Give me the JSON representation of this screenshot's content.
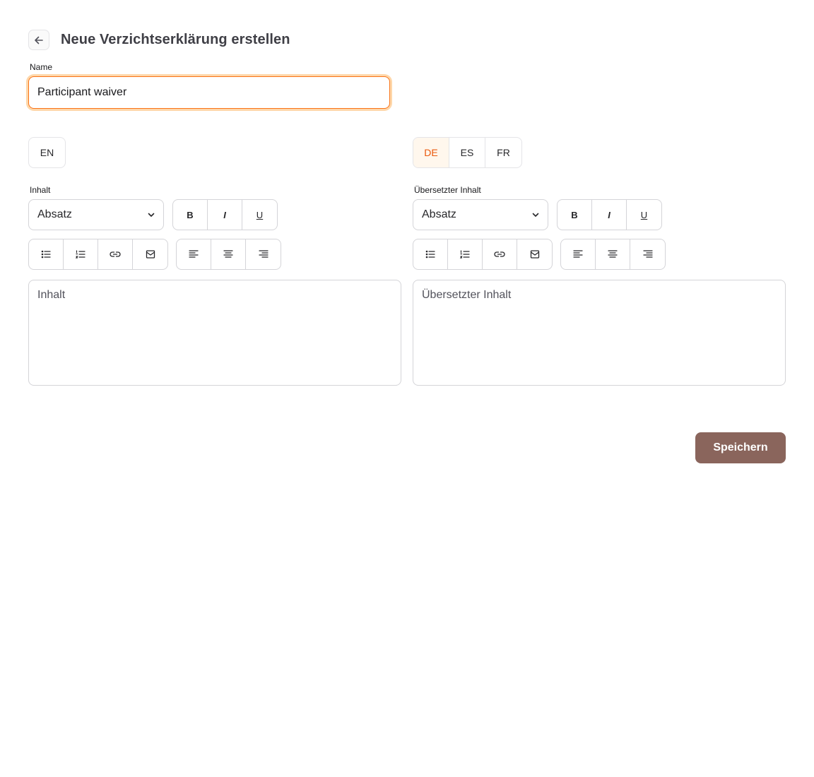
{
  "header": {
    "title": "Neue Verzichtserklärung erstellen"
  },
  "name_field": {
    "label": "Name",
    "value": "Participant waiver"
  },
  "source_panel": {
    "languages": [
      {
        "label": "EN",
        "active": false
      }
    ],
    "content_label": "Inhalt",
    "block_type": "Absatz",
    "editor_placeholder": "Inhalt"
  },
  "translation_panel": {
    "languages": [
      {
        "label": "DE",
        "active": true
      },
      {
        "label": "ES",
        "active": false
      },
      {
        "label": "FR",
        "active": false
      }
    ],
    "content_label": "Übersetzter Inhalt",
    "block_type": "Absatz",
    "editor_placeholder": "Übersetzter Inhalt"
  },
  "toolbar": {
    "bold": "B",
    "italic": "I",
    "underline": "U",
    "icons": [
      "bullet-list-icon",
      "numbered-list-icon",
      "link-icon",
      "mail-icon",
      "align-left-icon",
      "align-center-icon",
      "align-right-icon"
    ]
  },
  "actions": {
    "save_label": "Speichern"
  },
  "colors": {
    "accent": "#f97316",
    "active_tab_text": "#ea580c",
    "active_tab_bg": "#fff7ed",
    "save_button": "#8a655c"
  }
}
